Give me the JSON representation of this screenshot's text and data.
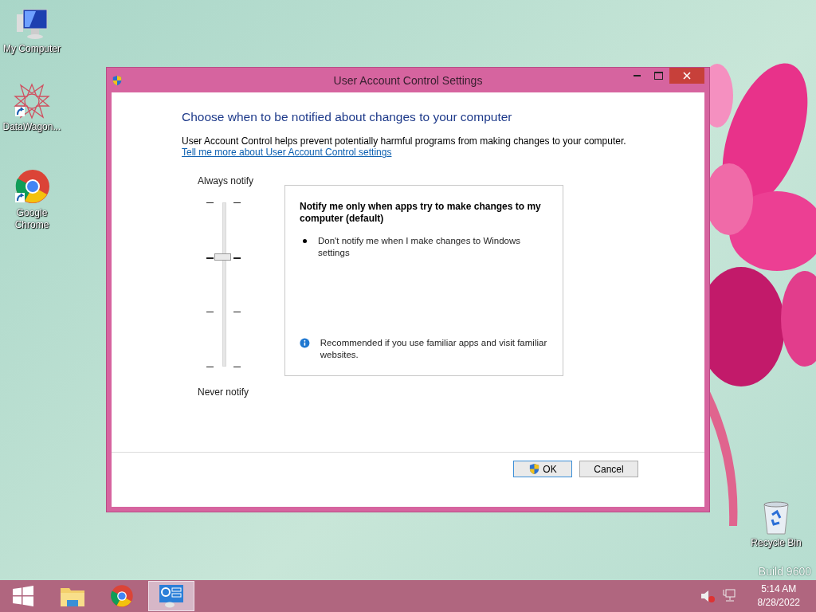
{
  "desktop_icons": [
    {
      "label": "My Computer",
      "kind": "computer",
      "shortcut": false
    },
    {
      "label": "DataWagon...",
      "kind": "star",
      "shortcut": true
    },
    {
      "label": "Google Chrome",
      "kind": "chrome",
      "shortcut": true
    },
    {
      "label": "Recycle Bin",
      "kind": "bin",
      "shortcut": false
    }
  ],
  "watermark": "Build 9600",
  "window": {
    "title": "User Account Control Settings",
    "heading": "Choose when to be notified about changes to your computer",
    "description": "User Account Control helps prevent potentially harmful programs from making changes to your computer.",
    "link": "Tell me more about User Account Control settings",
    "slider": {
      "top_label": "Always notify",
      "bottom_label": "Never notify",
      "level": 0.67
    },
    "info_box": {
      "title": "Notify me only when apps try to make changes to my computer (default)",
      "bullets": [
        "Don't notify me when I make changes to Windows settings"
      ],
      "note": "Recommended if you use familiar apps and visit familiar websites."
    },
    "buttons": [
      {
        "label": "OK",
        "kind": "shield"
      },
      {
        "label": "Cancel",
        "kind": "plain"
      }
    ]
  },
  "taskbar": {
    "items": [
      {
        "kind": "start",
        "selected": false
      },
      {
        "kind": "explorer",
        "selected": false
      },
      {
        "kind": "chrome",
        "selected": false
      },
      {
        "kind": "control-panel",
        "selected": true
      }
    ],
    "volume_muted": true,
    "time": "5:14 AM",
    "date": "8/28/2022"
  }
}
